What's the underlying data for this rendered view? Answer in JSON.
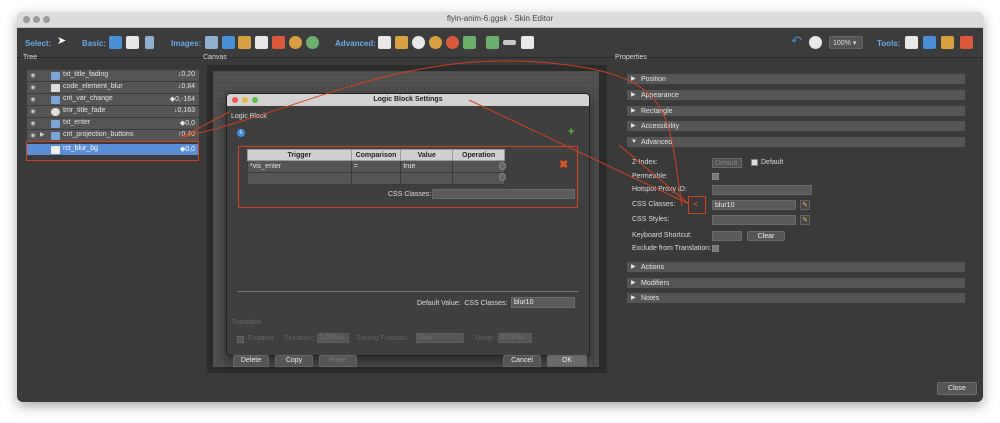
{
  "window": {
    "title": "flyin-anim-6.ggsk - Skin Editor"
  },
  "toolbar": {
    "select_label": "Select:",
    "basic_label": "Basic:",
    "images_label": "Images:",
    "advanced_label": "Advanced:",
    "tools_label": "Tools:",
    "zoom": "100%"
  },
  "panels": {
    "tree": "Tree",
    "canvas": "Canvas",
    "properties": "Properties"
  },
  "tree": {
    "rows": [
      {
        "label": "txt_title_fading",
        "value": "↓0,20"
      },
      {
        "label": "code_element_blur",
        "value": "↓0,84"
      },
      {
        "label": "cnt_var_change",
        "value": "◆0,-164"
      },
      {
        "label": "tmr_title_fade",
        "value": "↓0,163"
      },
      {
        "label": "txt_enter",
        "value": "◆0,0"
      },
      {
        "label": "cnt_projection_buttons",
        "value": "↑0,40"
      },
      {
        "label": "rct_blur_bg",
        "value": "◆0,0"
      }
    ]
  },
  "dialog": {
    "title": "Logic Block Settings",
    "section": "Logic Block",
    "info": "i",
    "add": "+",
    "remove": "✖",
    "table": {
      "headers": [
        "Trigger",
        "Comparison",
        "Value",
        "Operation"
      ],
      "rows": [
        [
          "*vis_enter",
          "=",
          "true",
          ""
        ],
        [
          "",
          "",
          "",
          ""
        ]
      ]
    },
    "css_classes_label": "CSS Classes:",
    "default_value_label": "Default Value:",
    "default_css_label": "CSS Classes:",
    "default_css_value": "blur10",
    "transition": {
      "title": "Transition",
      "enabled": "Enabled",
      "duration_label": "Duration:",
      "duration_value": "1,000sec",
      "easing_label": "Easing Function:",
      "easing_value": "Ease",
      "delay_label": "Delay:",
      "delay_value": "0,000sec"
    },
    "buttons": {
      "delete": "Delete",
      "copy": "Copy",
      "paste": "Paste",
      "cancel": "Cancel",
      "ok": "OK"
    }
  },
  "properties": {
    "sections_top": [
      "Position",
      "Appearance",
      "Rectangle",
      "Accessibility"
    ],
    "advanced": "Advanced",
    "zindex_label": "Z-Index:",
    "zindex_value": "Default",
    "default_label": "Default",
    "permeable_label": "Permeable:",
    "hotspot_label": "Hotspot Proxy ID:",
    "css_classes_label": "CSS Classes:",
    "css_classes_value": "blur10",
    "css_styles_label": "CSS Styles:",
    "keyboard_label": "Keyboard Shortcut:",
    "clear": "Clear",
    "exclude_label": "Exclude from Translation:",
    "sections_bottom": [
      "Actions",
      "Modifiers",
      "Notes"
    ]
  },
  "close": "Close"
}
